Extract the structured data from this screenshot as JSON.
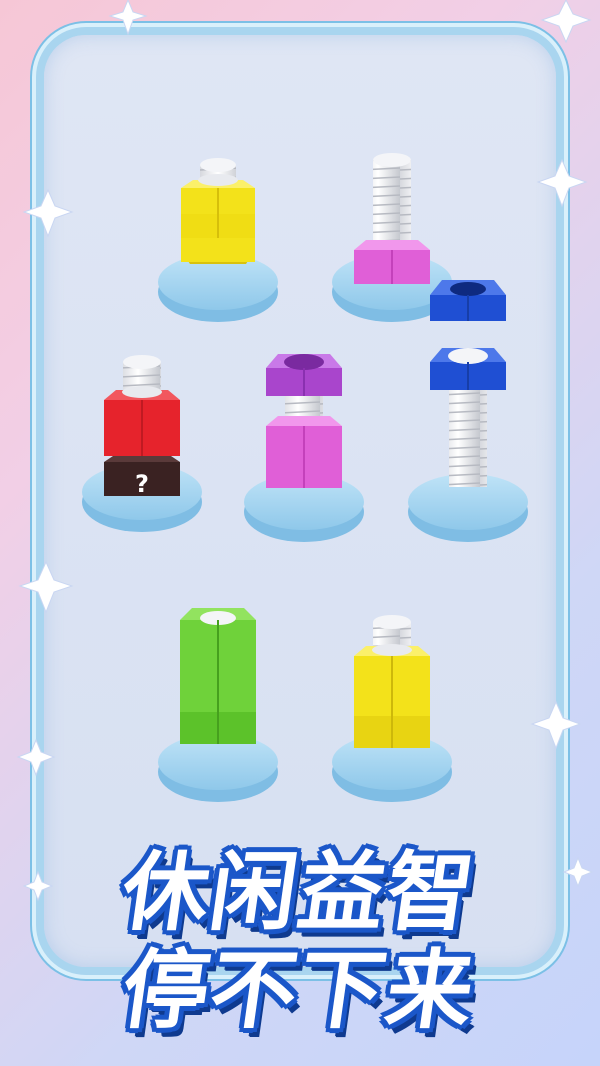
{
  "title": {
    "line1": "休闲益智",
    "line2": "停不下来"
  },
  "colors": {
    "yellow": "#f3e21a",
    "pink": "#e05fd7",
    "blue": "#1f4fd3",
    "red": "#e6232c",
    "dark": "#3a2222",
    "purple": "#b855d8",
    "green": "#6fd23a",
    "base": "#a9d8f2",
    "title_outline": "#1b57c9"
  },
  "board": {
    "stacks": [
      {
        "name": "stack-1",
        "nuts": [
          "yellow",
          "yellow",
          "yellow"
        ]
      },
      {
        "name": "stack-2",
        "nuts": [
          "pink"
        ]
      },
      {
        "name": "stack-3",
        "nuts": [
          "dark",
          "red",
          "red"
        ],
        "hidden_label": "?"
      },
      {
        "name": "stack-4",
        "nuts": [
          "pink",
          "pink"
        ],
        "floating_nut": "purple"
      },
      {
        "name": "stack-5",
        "nuts": [
          "blue"
        ],
        "floating_nut": "blue"
      },
      {
        "name": "stack-6",
        "nuts": [
          "green",
          "green",
          "green",
          "green"
        ]
      },
      {
        "name": "stack-7",
        "nuts": [
          "yellow",
          "yellow",
          "yellow"
        ]
      }
    ]
  }
}
